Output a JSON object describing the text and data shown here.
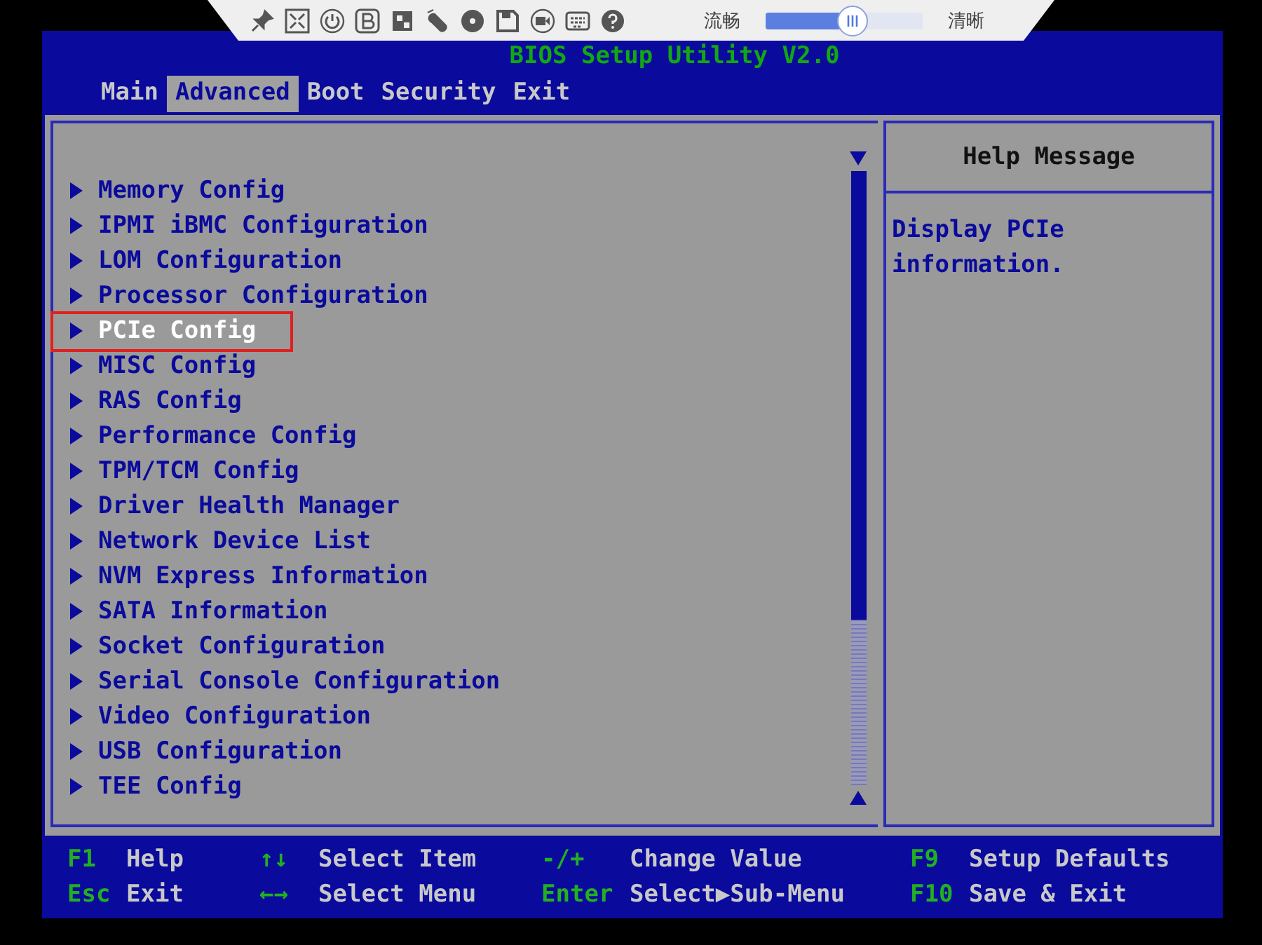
{
  "toolbar": {
    "quality_slider": {
      "left_label": "流畅",
      "right_label": "清晰",
      "level": 0.56
    }
  },
  "title": "BIOS Setup Utility V2.0",
  "tabs": [
    {
      "label": "Main",
      "selected": false
    },
    {
      "label": "Advanced",
      "selected": true
    },
    {
      "label": "Boot",
      "selected": false
    },
    {
      "label": "Security",
      "selected": false
    },
    {
      "label": "Exit",
      "selected": false
    }
  ],
  "menu_items": [
    {
      "label": "Memory Config",
      "selected": false
    },
    {
      "label": "IPMI iBMC Configuration",
      "selected": false
    },
    {
      "label": "LOM Configuration",
      "selected": false
    },
    {
      "label": "Processor Configuration",
      "selected": false
    },
    {
      "label": "PCIe Config",
      "selected": true
    },
    {
      "label": "MISC Config",
      "selected": false
    },
    {
      "label": "RAS Config",
      "selected": false
    },
    {
      "label": "Performance Config",
      "selected": false
    },
    {
      "label": "TPM/TCM Config",
      "selected": false
    },
    {
      "label": "Driver Health Manager",
      "selected": false
    },
    {
      "label": "Network Device List",
      "selected": false
    },
    {
      "label": "NVM Express Information",
      "selected": false
    },
    {
      "label": "SATA Information",
      "selected": false
    },
    {
      "label": "Socket Configuration",
      "selected": false
    },
    {
      "label": "Serial Console Configuration",
      "selected": false
    },
    {
      "label": "Video Configuration",
      "selected": false
    },
    {
      "label": "USB Configuration",
      "selected": false
    },
    {
      "label": "TEE Config",
      "selected": false
    }
  ],
  "help": {
    "title": "Help Message",
    "text": "Display PCIe information."
  },
  "footer": [
    {
      "key": "F1",
      "action": "Help"
    },
    {
      "key": "↑↓",
      "action": "Select Item"
    },
    {
      "key": "-/+",
      "action": "Change Value"
    },
    {
      "key": "F9",
      "action": "Setup Defaults"
    },
    {
      "key": "Esc",
      "action": "Exit"
    },
    {
      "key": "←→",
      "action": "Select Menu"
    },
    {
      "key": "Enter",
      "action": "Select▶Sub-Menu"
    },
    {
      "key": "F10",
      "action": "Save & Exit"
    }
  ]
}
